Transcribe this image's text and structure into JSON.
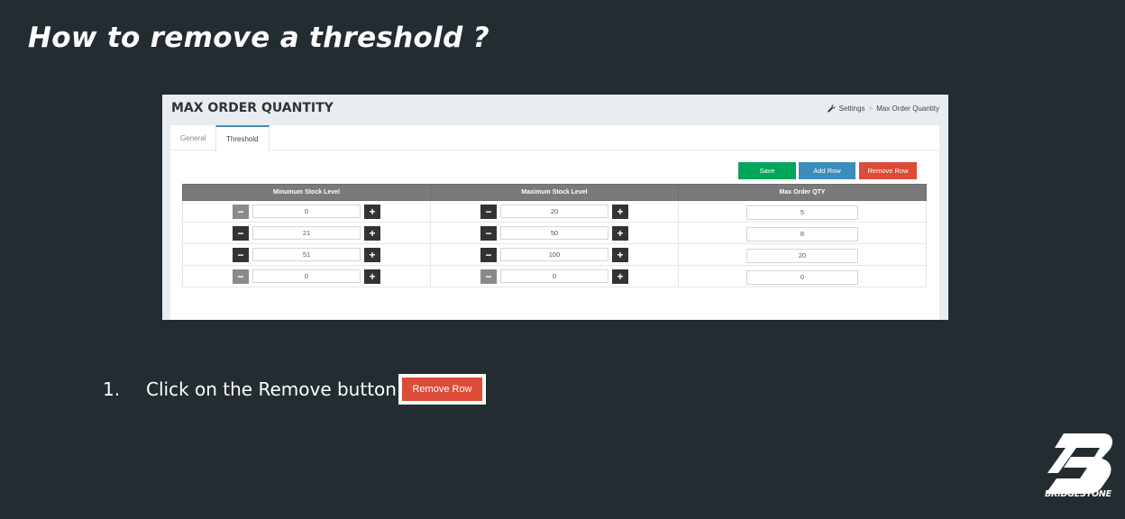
{
  "slide": {
    "title": "How to remove a threshold ?"
  },
  "screenshot": {
    "page_title": "MAX ORDER QUANTITY",
    "breadcrumb": {
      "icon": "wrench-icon",
      "items": [
        "Settings",
        "Max Order Quantity"
      ],
      "separator": ">"
    },
    "tabs": [
      {
        "label": "General",
        "active": false
      },
      {
        "label": "Threshold",
        "active": true
      }
    ],
    "actions": {
      "save_label": "Save",
      "add_row_label": "Add Row",
      "remove_row_label": "Remove Row"
    },
    "table": {
      "headers": [
        "Minumum Stock Level",
        "Maximum Stock Level",
        "Max Order QTY"
      ],
      "rows": [
        {
          "min": "0",
          "max": "20",
          "qty": "5"
        },
        {
          "min": "21",
          "max": "50",
          "qty": "8"
        },
        {
          "min": "51",
          "max": "100",
          "qty": "20"
        },
        {
          "min": "0",
          "max": "0",
          "qty": "0"
        }
      ]
    }
  },
  "instruction": {
    "number": "1.",
    "text": "Click on the Remove button",
    "button_label": "Remove Row"
  },
  "brand": {
    "name": "BRIDGESTONE"
  },
  "colors": {
    "background": "#232c31",
    "save": "#00a65a",
    "add": "#3c8dbc",
    "remove": "#dd4b39",
    "table_header": "#7a7a7a"
  }
}
